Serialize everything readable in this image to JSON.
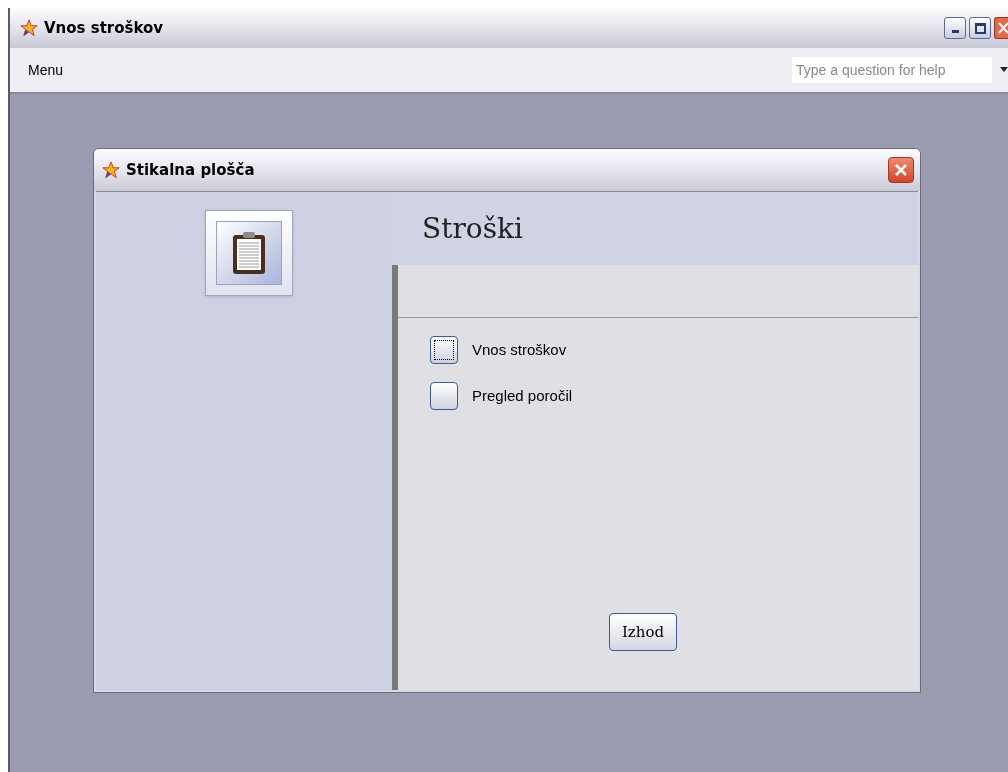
{
  "window": {
    "title": "Vnos stroškov"
  },
  "menu": {
    "items": [
      "Menu"
    ],
    "help_placeholder": "Type a question for help"
  },
  "dialog": {
    "title": "Stikalna plošča",
    "heading": "Stroški",
    "options": [
      {
        "label": "Vnos stroškov",
        "focused": true
      },
      {
        "label": "Pregled poročil",
        "focused": false
      }
    ],
    "exit_button": "Izhod"
  }
}
